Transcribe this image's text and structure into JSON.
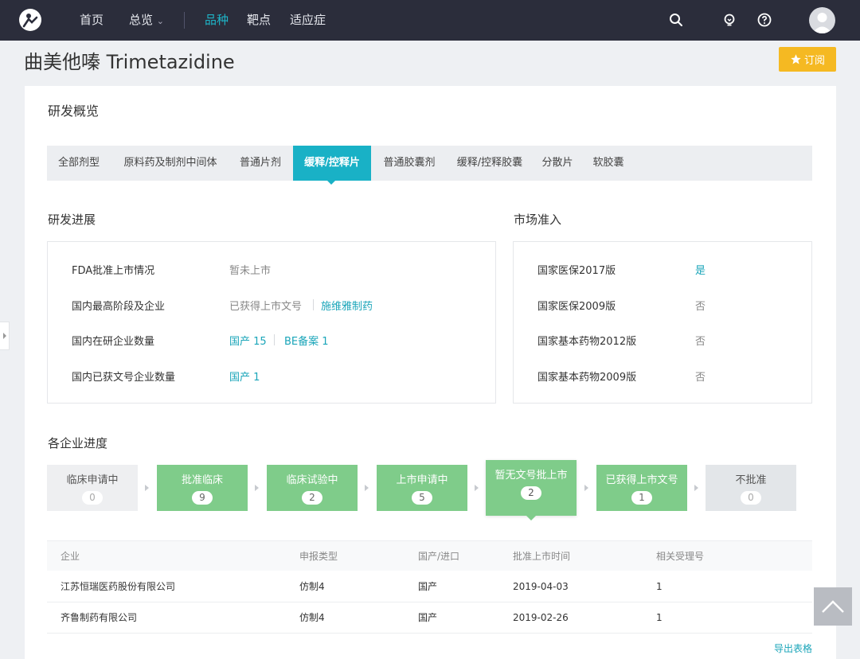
{
  "nav": {
    "items": [
      "首页",
      "总览",
      "品种",
      "靶点",
      "适应症"
    ],
    "active_index": 2,
    "overview_caret": "⌄"
  },
  "page": {
    "title": "曲美他嗪 Trimetazidine",
    "subscribe_label": "订阅"
  },
  "overview": {
    "title": "研发概览",
    "tabs": [
      "全部剂型",
      "原料药及制剂中间体",
      "普通片剂",
      "缓释/控释片",
      "普通胶囊剂",
      "缓释/控释胶囊",
      "分散片",
      "软胶囊"
    ],
    "active_tab": 3
  },
  "progress": {
    "title": "研发进展",
    "rows": [
      {
        "label": "FDA批准上市情况",
        "value": "暂未上市"
      },
      {
        "label": "国内最高阶段及企业",
        "value": "已获得上市文号",
        "link": "施维雅制药"
      },
      {
        "label": "国内在研企业数量",
        "link": "国产 15",
        "link2": "BE备案 1"
      },
      {
        "label": "国内已获文号企业数量",
        "link": "国产 1"
      }
    ]
  },
  "market": {
    "title": "市场准入",
    "rows": [
      {
        "label": "国家医保2017版",
        "value": "是"
      },
      {
        "label": "国家医保2009版",
        "value": "否"
      },
      {
        "label": "国家基本药物2012版",
        "value": "否"
      },
      {
        "label": "国家基本药物2009版",
        "value": "否"
      }
    ]
  },
  "stages": {
    "title": "各企业进度",
    "items": [
      {
        "label": "临床申请中",
        "count": "0"
      },
      {
        "label": "批准临床",
        "count": "9"
      },
      {
        "label": "临床试验中",
        "count": "2"
      },
      {
        "label": "上市申请中",
        "count": "5"
      },
      {
        "label": "暂无文号批上市",
        "count": "2"
      },
      {
        "label": "已获得上市文号",
        "count": "1"
      },
      {
        "label": "不批准",
        "count": "0"
      }
    ]
  },
  "table": {
    "headers": [
      "企业",
      "申报类型",
      "国产/进口",
      "批准上市时间",
      "相关受理号"
    ],
    "rows": [
      [
        "江苏恒瑞医药股份有限公司",
        "仿制4",
        "国产",
        "2019-04-03",
        "1"
      ],
      [
        "齐鲁制药有限公司",
        "仿制4",
        "国产",
        "2019-02-26",
        "1"
      ]
    ],
    "export_label": "导出表格"
  },
  "colors": {
    "accent": "#19b1c6",
    "green": "#7fcc8a",
    "gold": "#f5b922",
    "nav": "#2b2d3b"
  }
}
